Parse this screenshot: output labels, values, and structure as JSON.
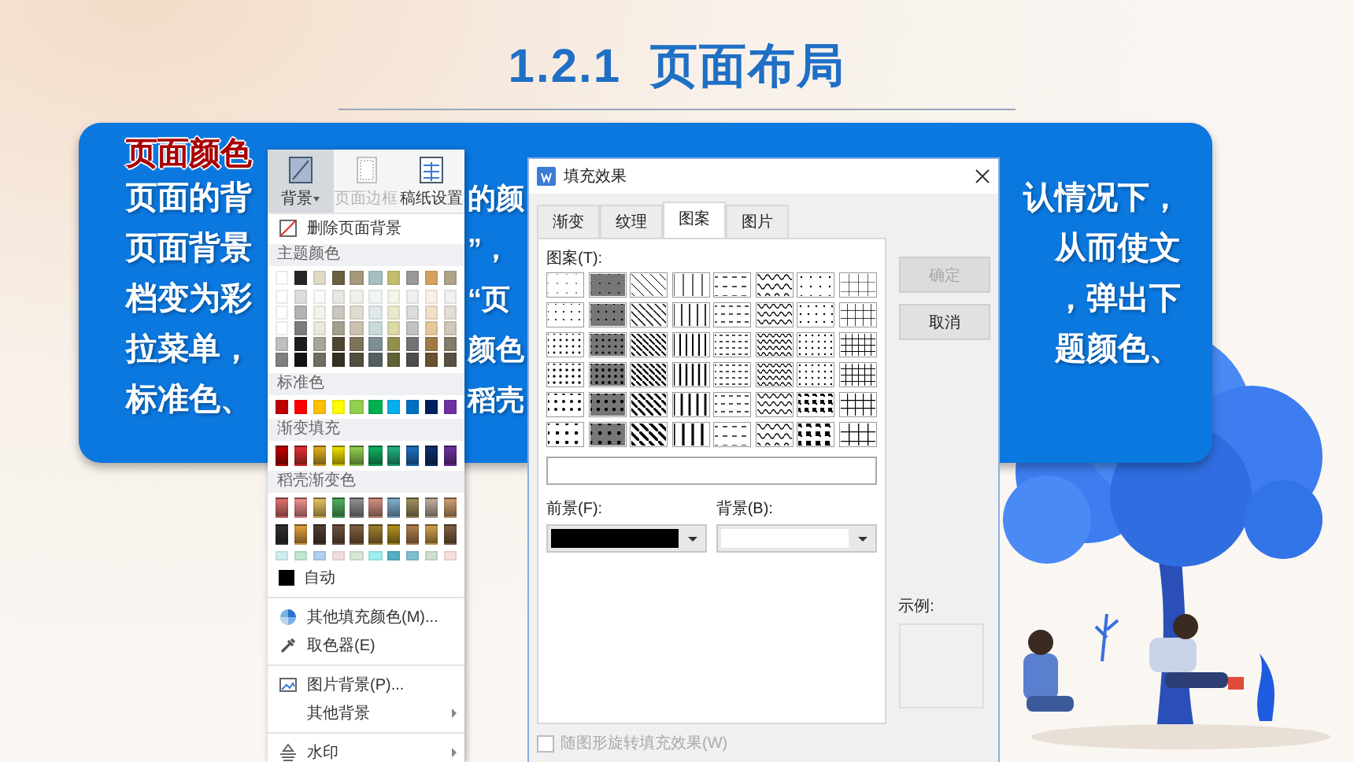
{
  "slide": {
    "title": "1.2.1  页面布局"
  },
  "card": {
    "heading": "页面颜色",
    "lines": [
      {
        "left": "页面的背",
        "middle": "的颜",
        "right": "认情况下，"
      },
      {
        "left": "页面背景",
        "middle": "”，",
        "right": "从而使文"
      },
      {
        "left": "档变为彩",
        "middle": "“页",
        "right": "，弹出下"
      },
      {
        "left": "拉菜单，",
        "middle": "颜色",
        "right": "题颜色、"
      },
      {
        "left": "标准色、",
        "middle": "稻壳"
      }
    ]
  },
  "menu": {
    "toolbar": [
      {
        "kind": "background",
        "label": "背景",
        "selected": true,
        "disabled": false,
        "has_caret": true
      },
      {
        "kind": "border",
        "label": "页面边框",
        "selected": false,
        "disabled": true,
        "has_caret": false
      },
      {
        "kind": "grid",
        "label": "稿纸设置",
        "selected": false,
        "disabled": false,
        "has_caret": false
      }
    ],
    "entries": [
      {
        "kind": "remove",
        "label": "删除页面背景"
      },
      {
        "kind": "header",
        "label": "主题颜色"
      },
      {
        "kind": "theme_swatches",
        "colors": [
          {
            "color": "#ffffff"
          },
          {
            "color": "#262626"
          },
          {
            "color": "#e0dcc6"
          },
          {
            "color": "#6b5f44"
          },
          {
            "color": "#a69a7a"
          },
          {
            "color": "#a7bfc4"
          },
          {
            "color": "#c4bf6a"
          },
          {
            "color": "#9a9a9a"
          },
          {
            "color": "#d6a35c"
          },
          {
            "color": "#b0a48a"
          }
        ]
      },
      {
        "kind": "header",
        "label": "标准色"
      },
      {
        "kind": "swatches",
        "colors": [
          {
            "color": "#c00000"
          },
          {
            "color": "#ff0000"
          },
          {
            "color": "#ffc000"
          },
          {
            "color": "#ffff00"
          },
          {
            "color": "#92d050"
          },
          {
            "color": "#00b050"
          },
          {
            "color": "#00b0f0"
          },
          {
            "color": "#0070c0"
          },
          {
            "color": "#002060"
          },
          {
            "color": "#7030a0"
          }
        ]
      },
      {
        "kind": "header",
        "label": "渐变填充"
      },
      {
        "kind": "gradient_swatches",
        "colors": [
          {
            "color": "#c00000"
          },
          {
            "color": "#e03030"
          },
          {
            "color": "#e0b020"
          },
          {
            "color": "#f0e000"
          },
          {
            "color": "#92d050"
          },
          {
            "color": "#10b060"
          },
          {
            "color": "#20b080"
          },
          {
            "color": "#2070c0"
          },
          {
            "color": "#103070"
          },
          {
            "color": "#7030a0"
          }
        ]
      },
      {
        "kind": "header",
        "label": "稻壳渐变色"
      },
      {
        "kind": "gradient_swatches",
        "colors": [
          {
            "color": "#e07070"
          },
          {
            "color": "#f09090"
          },
          {
            "color": "#e8c060"
          },
          {
            "color": "#50b060"
          },
          {
            "color": "#909090"
          },
          {
            "color": "#d09080"
          },
          {
            "color": "#80b0d0"
          },
          {
            "color": "#a09060"
          },
          {
            "color": "#c0b0a0"
          },
          {
            "color": "#d0a070"
          }
        ]
      },
      {
        "kind": "gradient_swatches",
        "colors": [
          {
            "color": "#303030"
          },
          {
            "color": "#e0a040"
          },
          {
            "color": "#504030"
          },
          {
            "color": "#705040"
          },
          {
            "color": "#806040"
          },
          {
            "color": "#a08030"
          },
          {
            "color": "#b09020"
          },
          {
            "color": "#b08050"
          },
          {
            "color": "#d0a050"
          },
          {
            "color": "#806040"
          }
        ]
      },
      {
        "kind": "pale_swatches",
        "colors": [
          {
            "color": "#d0f0f0"
          },
          {
            "color": "#c0e8d0"
          },
          {
            "color": "#b0d0f0"
          },
          {
            "color": "#f0e0e0"
          },
          {
            "color": "#d8e8d8"
          },
          {
            "color": "#a0f0f0"
          },
          {
            "color": "#50b0c0"
          },
          {
            "color": "#80c0d0"
          },
          {
            "color": "#d0e0d0"
          },
          {
            "color": "#f8e0e0"
          }
        ]
      },
      {
        "kind": "auto",
        "label": "自动",
        "color": "#000000"
      },
      {
        "kind": "divider"
      },
      {
        "kind": "more_colors",
        "label": "其他填充颜色(M)..."
      },
      {
        "kind": "picker",
        "label": "取色器(E)"
      },
      {
        "kind": "divider"
      },
      {
        "kind": "picture",
        "label": "图片背景(P)...",
        "has_submenu": false
      },
      {
        "kind": "plain",
        "label": "其他背景",
        "has_submenu": true
      },
      {
        "kind": "divider"
      },
      {
        "kind": "watermark",
        "label": "水印",
        "has_submenu": true
      }
    ]
  },
  "dialog": {
    "title": "填充效果",
    "tabs": [
      {
        "label": "渐变",
        "selected": false
      },
      {
        "label": "纹理",
        "selected": false
      },
      {
        "label": "图案",
        "selected": true
      },
      {
        "label": "图片",
        "selected": false
      }
    ],
    "pattern_label": "图案(T):",
    "foreground": {
      "label": "前景(F):",
      "color": "#000000"
    },
    "background": {
      "label": "背景(B):",
      "color": "#ffffff"
    },
    "buttons": [
      {
        "label": "确定",
        "disabled": true
      },
      {
        "label": "取消",
        "disabled": false
      }
    ],
    "preview_label": "示例:",
    "rotate_option": {
      "label": "随图形旋转填充效果(W)",
      "checked": false,
      "disabled": true
    }
  }
}
